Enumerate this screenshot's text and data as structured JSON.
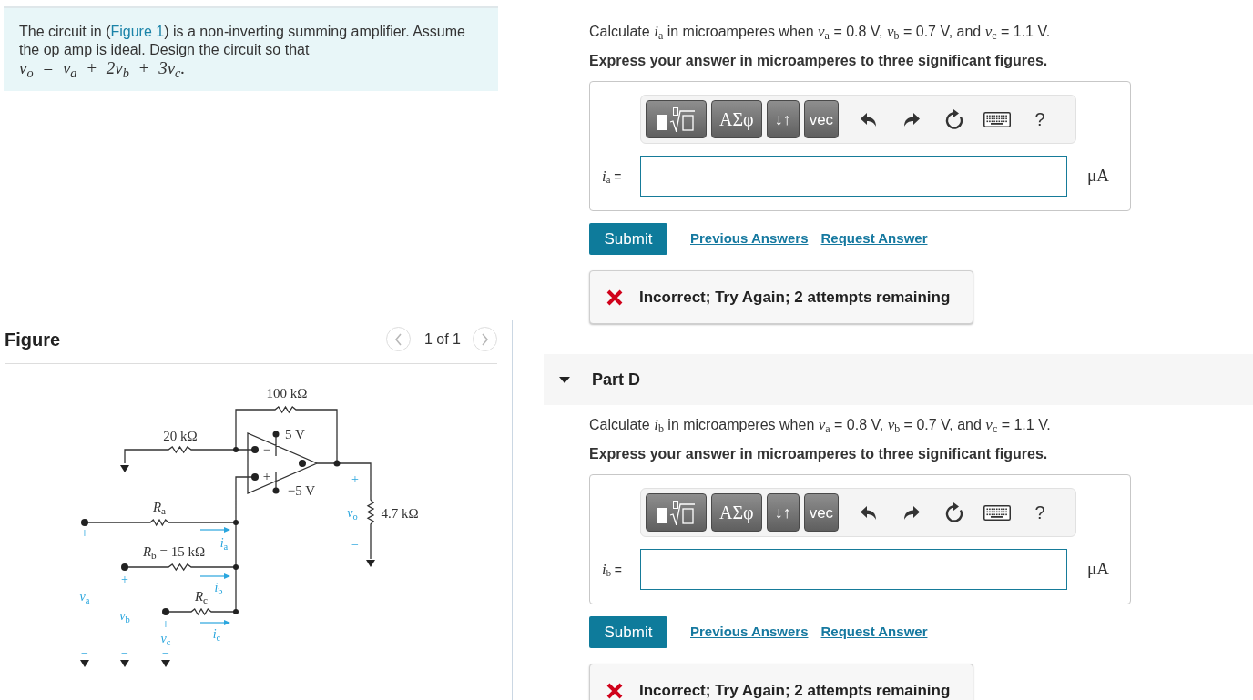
{
  "problem": {
    "before": "The circuit in (",
    "link": "Figure 1",
    "after": ") is a non-inverting summing amplifier. Assume the op amp is ideal. Design the circuit so that",
    "formula": "v$_{o}$ = v$_{a}$ + 2v$_{b}$ + 3v$_{c}$."
  },
  "figure": {
    "title": "Figure",
    "pager": "1 of 1",
    "component_labels": [
      "100 kΩ",
      "20 kΩ",
      "5 V",
      "−5 V",
      "−",
      "+",
      "*R*$_{a}$",
      "*R*$_{b}$ = 15 kΩ",
      "*R*$_{c}$",
      "4.7 kΩ"
    ],
    "signal_labels": [
      "*i*$_{a}$",
      "*i*$_{b}$",
      "*i*$_{c}$",
      "*v*$_{a}$",
      "*v*$_{b}$",
      "*v*$_{c}$",
      "*v*$_{o}$",
      "+",
      "+",
      "+",
      "+",
      "−",
      "−",
      "−",
      "−"
    ]
  },
  "parts": [
    {
      "question": "Calculate *i*$_{a}$ in microamperes when *v*$_{a}$ = 0.8 V, *v*$_{b}$ = 0.7 V, and *v*$_{c}$ = 1.1 V.",
      "instruction": "Express your answer in microamperes to three significant figures.",
      "toolbar": {
        "buttons": [
          "ΑΣφ",
          "↓↑",
          "vec"
        ],
        "help": "?"
      },
      "answer": {
        "label": "*i*$_{a}$ =",
        "unit": "μA"
      },
      "submit": "Submit",
      "links": [
        "Previous Answers",
        "Request Answer"
      ],
      "feedback": {
        "kind": "incorrect",
        "text": "Incorrect; Try Again; 2 attempts remaining"
      }
    },
    {
      "header": {
        "title": "Part D",
        "expanded": true
      },
      "question": "Calculate *i*$_{b}$ in microamperes when *v*$_{a}$ = 0.8 V, *v*$_{b}$ = 0.7 V, and *v*$_{c}$ = 1.1 V.",
      "instruction": "Express your answer in microamperes to three significant figures.",
      "toolbar": {
        "buttons": [
          "ΑΣφ",
          "↓↑",
          "vec"
        ],
        "help": "?"
      },
      "answer": {
        "label": "*i*$_{b}$ =",
        "unit": "μA"
      },
      "submit": "Submit",
      "links": [
        "Previous Answers",
        "Request Answer"
      ],
      "feedback": {
        "kind": "incorrect",
        "text": "Incorrect; Try Again; 2 attempts remaining"
      }
    }
  ]
}
